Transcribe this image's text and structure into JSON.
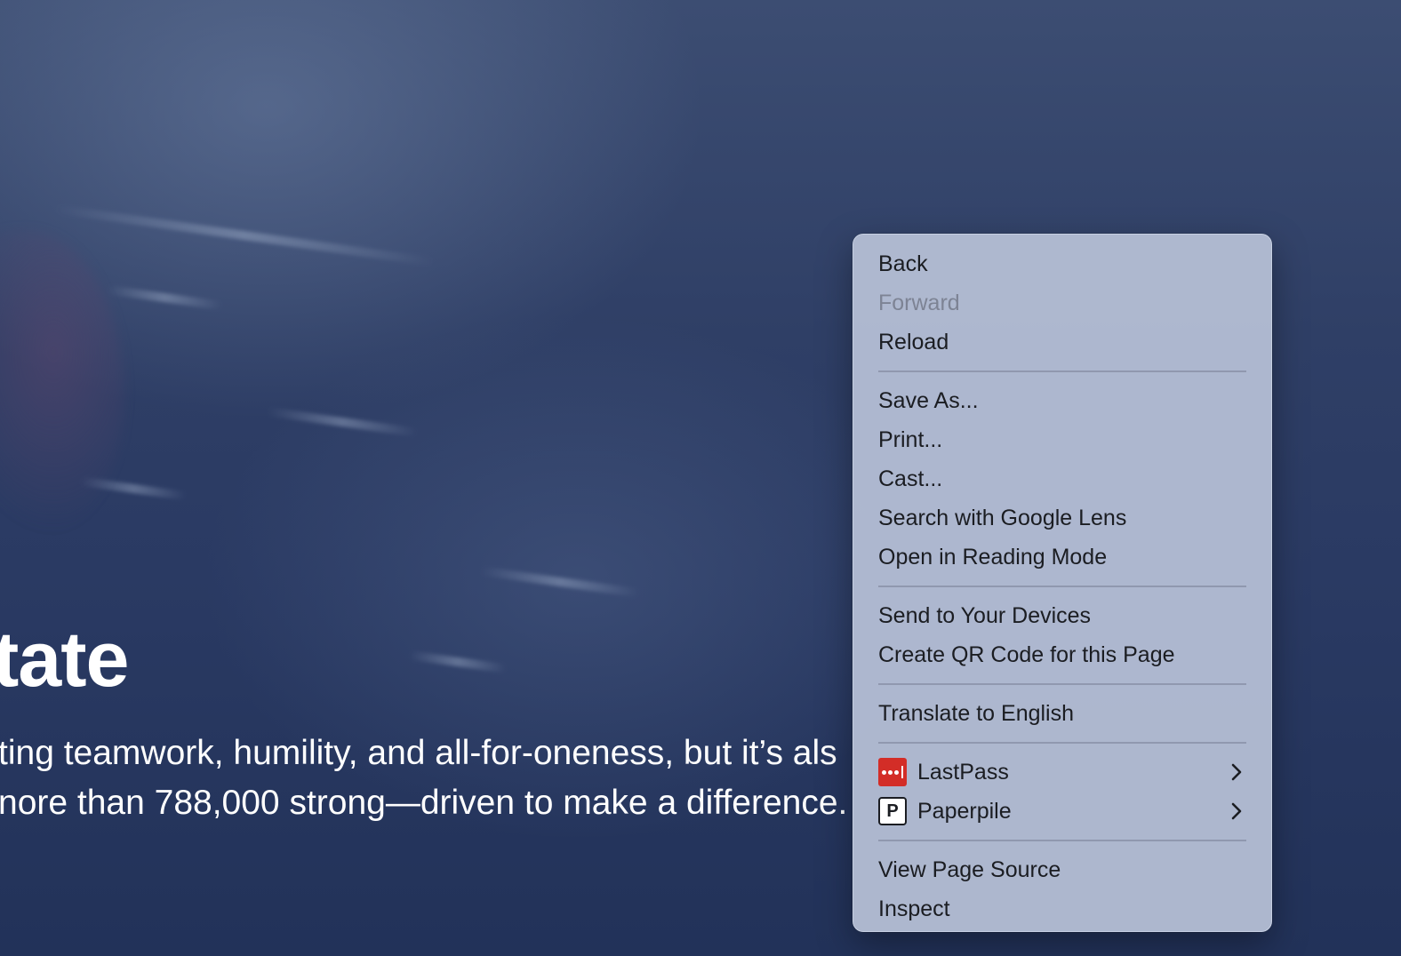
{
  "hero": {
    "title": "tate",
    "paragraph_lines": [
      "ting teamwork, humility, and all-for-oneness, but it’s als",
      "nore than 788,000 strong—driven to make a difference."
    ]
  },
  "context_menu": {
    "groups": [
      [
        {
          "label": "Back",
          "disabled": false
        },
        {
          "label": "Forward",
          "disabled": true
        },
        {
          "label": "Reload",
          "disabled": false
        }
      ],
      [
        {
          "label": "Save As...",
          "disabled": false
        },
        {
          "label": "Print...",
          "disabled": false
        },
        {
          "label": "Cast...",
          "disabled": false
        },
        {
          "label": "Search with Google Lens",
          "disabled": false
        },
        {
          "label": "Open in Reading Mode",
          "disabled": false
        }
      ],
      [
        {
          "label": "Send to Your Devices",
          "disabled": false
        },
        {
          "label": "Create QR Code for this Page",
          "disabled": false
        }
      ],
      [
        {
          "label": "Translate to English",
          "disabled": false
        }
      ],
      [
        {
          "label": "LastPass",
          "icon": "lastpass-icon",
          "submenu": true,
          "icon_color": "#d32d27"
        },
        {
          "label": "Paperpile",
          "icon": "paperpile-icon",
          "submenu": true,
          "icon_glyph": "P"
        }
      ],
      [
        {
          "label": "View Page Source",
          "disabled": false
        },
        {
          "label": "Inspect",
          "disabled": false
        }
      ]
    ]
  },
  "colors": {
    "menu_background": "#b6bfd6",
    "menu_text": "#1b1d22",
    "menu_text_disabled": "#7d8394",
    "page_background": "#2a3a63",
    "lastpass_red": "#d32d27"
  }
}
